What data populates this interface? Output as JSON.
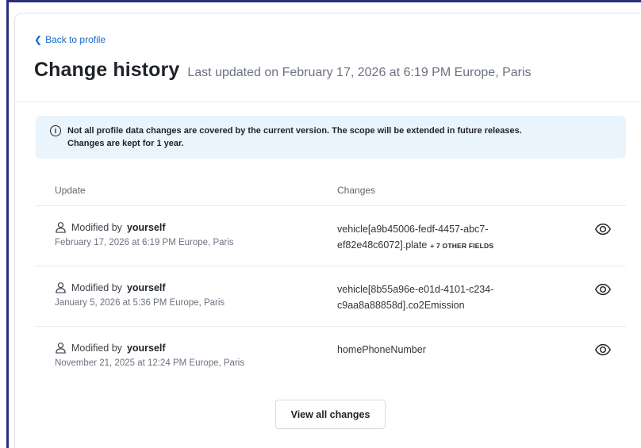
{
  "header": {
    "back_link": "Back to profile",
    "title": "Change history",
    "last_updated": "Last updated on February 17, 2026 at 6:19 PM Europe, Paris"
  },
  "notice": {
    "text_line1": "Not all profile data changes are covered by the current version. The scope will be extended in future releases.",
    "text_line2": "Changes are kept for 1 year."
  },
  "table": {
    "columns": [
      "Update",
      "Changes"
    ],
    "rows": [
      {
        "modified_prefix": "Modified by",
        "modified_by": "yourself",
        "date": "February 17, 2026 at 6:19 PM Europe, Paris",
        "change_line1": "vehicle[a9b45006-fedf-4457-abc7-",
        "change_line2": "ef82e48c6072].plate",
        "extra": "+ 7 OTHER FIELDS"
      },
      {
        "modified_prefix": "Modified by",
        "modified_by": "yourself",
        "date": "January 5, 2026 at 5:36 PM Europe, Paris",
        "change_line1": "vehicle[8b55a96e-e01d-4101-c234-",
        "change_line2": "c9aa8a88858d].co2Emission",
        "extra": ""
      },
      {
        "modified_prefix": "Modified by",
        "modified_by": "yourself",
        "date": "November 21, 2025 at 12:24 PM Europe, Paris",
        "change_line1": "homePhoneNumber",
        "change_line2": "",
        "extra": ""
      }
    ]
  },
  "actions": {
    "view_all": "View all changes"
  },
  "icons": {
    "back": "chevron-left-icon",
    "info": "info-icon",
    "user": "user-icon",
    "view": "eye-icon"
  },
  "colors": {
    "link": "#1769c7",
    "notice_bg": "#eaf4fc",
    "frame": "#2a2f7a"
  }
}
